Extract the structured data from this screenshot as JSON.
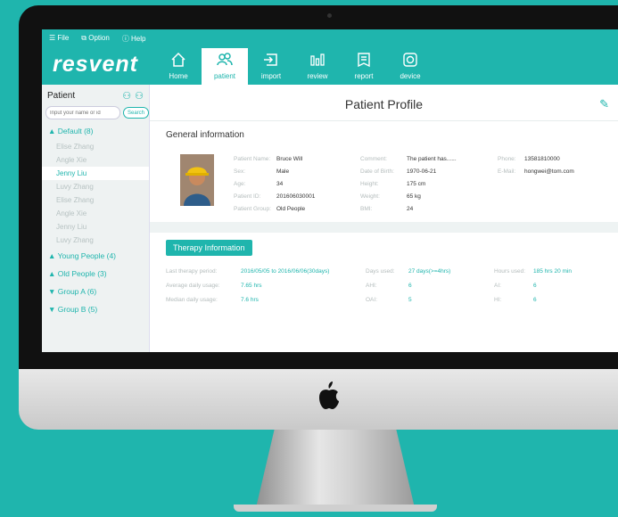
{
  "menu": {
    "file": "☰ File",
    "option": "⧉ Option",
    "help": "ⓘ Help"
  },
  "logo": "resvent",
  "nav": [
    {
      "label": "Home",
      "icon": "home-icon"
    },
    {
      "label": "patient",
      "icon": "patients-icon",
      "active": true
    },
    {
      "label": "import",
      "icon": "import-icon"
    },
    {
      "label": "review",
      "icon": "review-icon"
    },
    {
      "label": "report",
      "icon": "report-icon"
    },
    {
      "label": "device",
      "icon": "device-icon"
    }
  ],
  "sidebar": {
    "title": "Patient",
    "search_placeholder": "Input your name or id",
    "search_button": "Search",
    "groups": [
      {
        "label": "▲ Default (8)",
        "patients": [
          "Elise Zhang",
          "Angle Xie",
          "Jenny Liu",
          "Luvy Zhang",
          "Elise Zhang",
          "Angle Xie",
          "Jenny Liu",
          "Luvy Zhang"
        ],
        "selected": 2
      },
      {
        "label": "▲ Young People (4)"
      },
      {
        "label": "▲ Old People (3)"
      },
      {
        "label": "▼ Group A (6)"
      },
      {
        "label": "▼ Group B (5)"
      }
    ]
  },
  "main": {
    "title": "Patient Profile",
    "general": {
      "title": "General information",
      "fields": {
        "name_k": "Patient Name:",
        "name_v": "Bruce Will",
        "sex_k": "Sex:",
        "sex_v": "Male",
        "age_k": "Age:",
        "age_v": "34",
        "id_k": "Patient ID:",
        "id_v": "201606030001",
        "group_k": "Patient Group:",
        "group_v": "Old People",
        "comment_k": "Comment:",
        "comment_v": "The patient has......",
        "dob_k": "Date of Birth:",
        "dob_v": "1970-06-21",
        "height_k": "Height:",
        "height_v": "175 cm",
        "weight_k": "Weight:",
        "weight_v": "65 kg",
        "bmi_k": "BMI:",
        "bmi_v": "24",
        "phone_k": "Phone:",
        "phone_v": "13581810000",
        "email_k": "E-Mail:",
        "email_v": "hongwei@tom.com"
      }
    },
    "therapy": {
      "title": "Therapy Information",
      "fields": {
        "period_k": "Last therapy period:",
        "period_v": "2016/05/05 to 2016/06/06(30days)",
        "avg_k": "Average daily usage:",
        "avg_v": "7.65 hrs",
        "median_k": "Median daily usage:",
        "median_v": "7.6 hrs",
        "days_k": "Days used:",
        "days_v": "27 days(>=4hrs)",
        "ahi_k": "AHI:",
        "ahi_v": "6",
        "oai_k": "OAI:",
        "oai_v": "5",
        "hours_k": "Hours used:",
        "hours_v": "185 hrs 20 min",
        "ai_k": "AI:",
        "ai_v": "6",
        "hi_k": "HI:",
        "hi_v": "6"
      }
    }
  }
}
